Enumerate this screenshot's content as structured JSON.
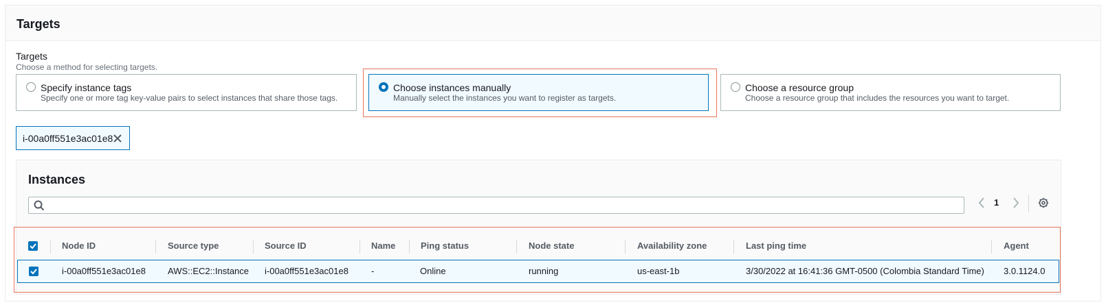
{
  "panel": {
    "title": "Targets"
  },
  "targets_field": {
    "label": "Targets",
    "description": "Choose a method for selecting targets.",
    "options": [
      {
        "title": "Specify instance tags",
        "description": "Specify one or more tag key-value pairs to select instances that share those tags.",
        "selected": false
      },
      {
        "title": "Choose instances manually",
        "description": "Manually select the instances you want to register as targets.",
        "selected": true
      },
      {
        "title": "Choose a resource group",
        "description": "Choose a resource group that includes the resources you want to target.",
        "selected": false
      }
    ]
  },
  "selected_token": {
    "label": "i-00a0ff551e3ac01e8",
    "icon": "close-icon"
  },
  "instances": {
    "title": "Instances",
    "search": {
      "value": "",
      "placeholder": "",
      "icon": "search-icon"
    },
    "pagination": {
      "current_page": "1",
      "prev_icon": "chevron-left-icon",
      "next_icon": "chevron-right-icon"
    },
    "settings_icon": "gear-icon",
    "columns": [
      "Node ID",
      "Source type",
      "Source ID",
      "Name",
      "Ping status",
      "Node state",
      "Availability zone",
      "Last ping time",
      "Agent version"
    ],
    "rows": [
      {
        "checked": true,
        "cells": [
          "i-00a0ff551e3ac01e8",
          "AWS::EC2::Instance",
          "i-00a0ff551e3ac01e8",
          "-",
          "Online",
          "running",
          "us-east-1b",
          "3/30/2022 at 16:41:36 GMT-0500 (Colombia Standard Time)",
          "3.0.1124.0"
        ]
      }
    ],
    "select_all_checked": true
  },
  "colors": {
    "accent": "#0073bb",
    "selected_bg": "#f1faff",
    "highlight": "#e8745c"
  }
}
